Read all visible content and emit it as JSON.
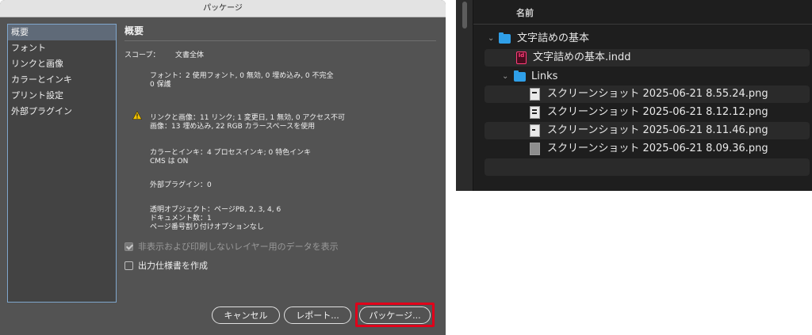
{
  "dialog": {
    "title": "パッケージ",
    "sidebar": {
      "items": [
        {
          "label": "概要"
        },
        {
          "label": "フォント"
        },
        {
          "label": "リンクと画像"
        },
        {
          "label": "カラーとインキ"
        },
        {
          "label": "プリント設定"
        },
        {
          "label": "外部プラグイン"
        }
      ],
      "selected": "概要"
    },
    "summary": {
      "section_title": "概要",
      "scope_label": "スコープ：",
      "scope_value": "文書全体",
      "fonts_line1": "フォント：2 使用フォント, 0 無効, 0 埋め込み, 0 不完全",
      "fonts_line2": "0 保護",
      "links_line1": "リンクと画像：11 リンク; 1 変更日, 1 無効, 0 アクセス不可",
      "links_line2": "画像：13 埋め込み, 22 RGB カラースペースを使用",
      "colors_line1": "カラーとインキ：4 プロセスインキ; 0 特色インキ",
      "colors_line2": "CMS は ON",
      "plugins_line1": "外部プラグイン：0",
      "transparency_line1": "透明オブジェクト：ページPB, 2, 3, 4, 6",
      "transparency_line2": "ドキュメント数：1",
      "transparency_line3": "ページ番号割り付けオプションなし"
    },
    "options": {
      "hidden_layers_label": "非表示および印刷しないレイヤー用のデータを表示",
      "hidden_layers_checked": true,
      "hidden_layers_enabled": false,
      "output_spec_label": "出力仕様書を作成",
      "output_spec_checked": false
    },
    "buttons": {
      "cancel": "キャンセル",
      "report": "レポート...",
      "package": "パッケージ..."
    },
    "colors": {
      "highlight": "#e0001a",
      "warning": "#f2c200"
    }
  },
  "finder": {
    "column_header": "名前",
    "rows": [
      {
        "label": "文字詰めの基本",
        "icon": "folder-icon",
        "expanded": true
      },
      {
        "label": "文字詰めの基本.indd",
        "icon": "indd-file-icon",
        "icon_text": "Id"
      },
      {
        "label": "Links",
        "icon": "folder-icon",
        "expanded": true
      },
      {
        "label": "スクリーンショット 2025-06-21 8.55.24.png",
        "icon": "image-file-icon"
      },
      {
        "label": "スクリーンショット 2025-06-21 8.12.12.png",
        "icon": "image-file-icon"
      },
      {
        "label": "スクリーンショット 2025-06-21 8.11.46.png",
        "icon": "image-file-icon"
      },
      {
        "label": "スクリーンショット 2025-06-21 8.09.36.png",
        "icon": "image-file-icon"
      }
    ]
  }
}
